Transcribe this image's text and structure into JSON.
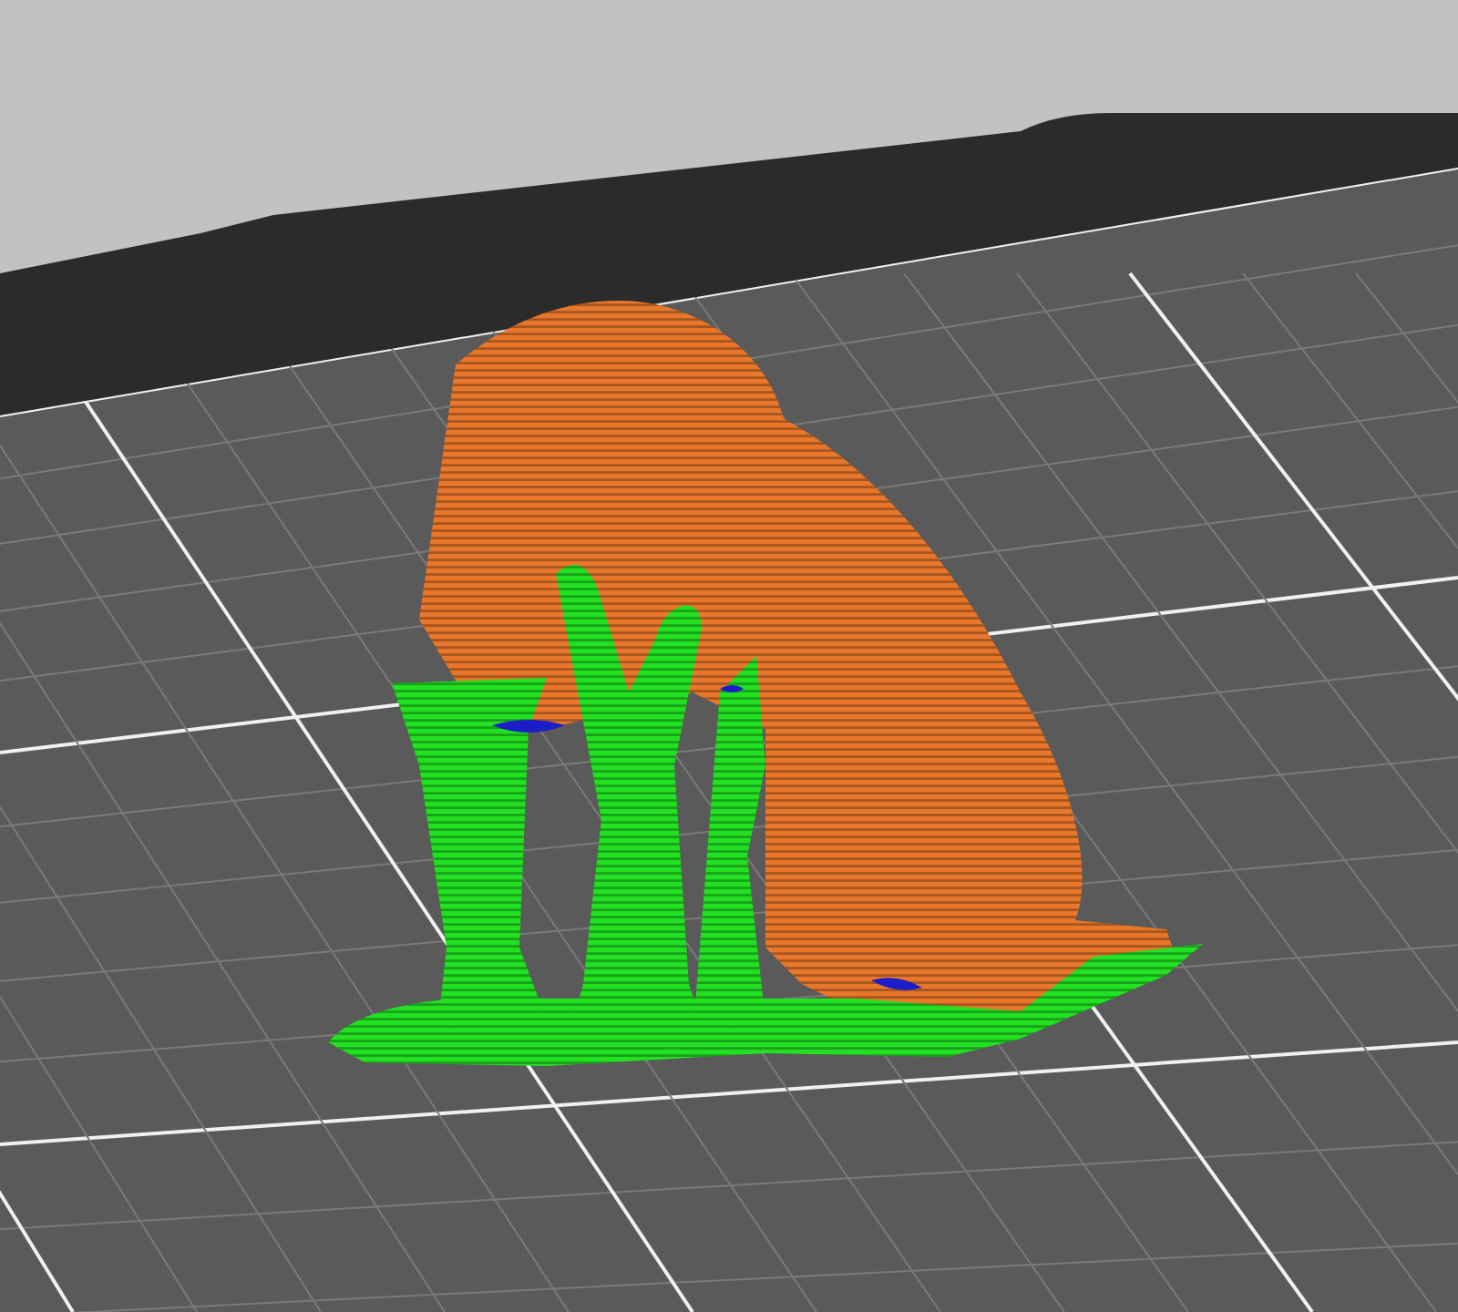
{
  "viewport": {
    "features": [
      {
        "kind": "model",
        "color": "#e8772c"
      },
      {
        "kind": "support",
        "color": "#22e022"
      },
      {
        "kind": "interface",
        "color": "#1c1cc8"
      }
    ]
  }
}
